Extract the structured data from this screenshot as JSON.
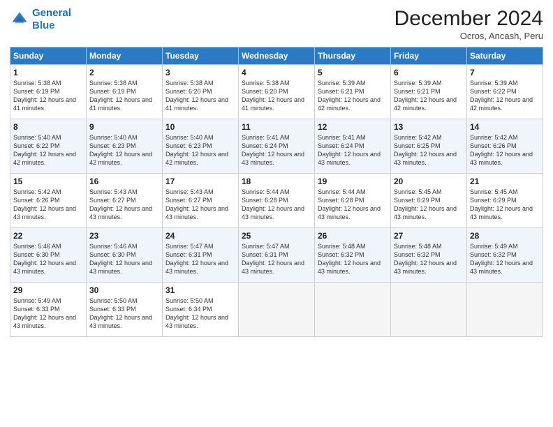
{
  "header": {
    "logo_line1": "General",
    "logo_line2": "Blue",
    "month": "December 2024",
    "location": "Ocros, Ancash, Peru"
  },
  "days_of_week": [
    "Sunday",
    "Monday",
    "Tuesday",
    "Wednesday",
    "Thursday",
    "Friday",
    "Saturday"
  ],
  "weeks": [
    [
      {
        "day": "1",
        "info": "Sunrise: 5:38 AM\nSunset: 6:19 PM\nDaylight: 12 hours and 41 minutes."
      },
      {
        "day": "2",
        "info": "Sunrise: 5:38 AM\nSunset: 6:19 PM\nDaylight: 12 hours and 41 minutes."
      },
      {
        "day": "3",
        "info": "Sunrise: 5:38 AM\nSunset: 6:20 PM\nDaylight: 12 hours and 41 minutes."
      },
      {
        "day": "4",
        "info": "Sunrise: 5:38 AM\nSunset: 6:20 PM\nDaylight: 12 hours and 41 minutes."
      },
      {
        "day": "5",
        "info": "Sunrise: 5:39 AM\nSunset: 6:21 PM\nDaylight: 12 hours and 42 minutes."
      },
      {
        "day": "6",
        "info": "Sunrise: 5:39 AM\nSunset: 6:21 PM\nDaylight: 12 hours and 42 minutes."
      },
      {
        "day": "7",
        "info": "Sunrise: 5:39 AM\nSunset: 6:22 PM\nDaylight: 12 hours and 42 minutes."
      }
    ],
    [
      {
        "day": "8",
        "info": "Sunrise: 5:40 AM\nSunset: 6:22 PM\nDaylight: 12 hours and 42 minutes."
      },
      {
        "day": "9",
        "info": "Sunrise: 5:40 AM\nSunset: 6:23 PM\nDaylight: 12 hours and 42 minutes."
      },
      {
        "day": "10",
        "info": "Sunrise: 5:40 AM\nSunset: 6:23 PM\nDaylight: 12 hours and 42 minutes."
      },
      {
        "day": "11",
        "info": "Sunrise: 5:41 AM\nSunset: 6:24 PM\nDaylight: 12 hours and 43 minutes."
      },
      {
        "day": "12",
        "info": "Sunrise: 5:41 AM\nSunset: 6:24 PM\nDaylight: 12 hours and 43 minutes."
      },
      {
        "day": "13",
        "info": "Sunrise: 5:42 AM\nSunset: 6:25 PM\nDaylight: 12 hours and 43 minutes."
      },
      {
        "day": "14",
        "info": "Sunrise: 5:42 AM\nSunset: 6:26 PM\nDaylight: 12 hours and 43 minutes."
      }
    ],
    [
      {
        "day": "15",
        "info": "Sunrise: 5:42 AM\nSunset: 6:26 PM\nDaylight: 12 hours and 43 minutes."
      },
      {
        "day": "16",
        "info": "Sunrise: 5:43 AM\nSunset: 6:27 PM\nDaylight: 12 hours and 43 minutes."
      },
      {
        "day": "17",
        "info": "Sunrise: 5:43 AM\nSunset: 6:27 PM\nDaylight: 12 hours and 43 minutes."
      },
      {
        "day": "18",
        "info": "Sunrise: 5:44 AM\nSunset: 6:28 PM\nDaylight: 12 hours and 43 minutes."
      },
      {
        "day": "19",
        "info": "Sunrise: 5:44 AM\nSunset: 6:28 PM\nDaylight: 12 hours and 43 minutes."
      },
      {
        "day": "20",
        "info": "Sunrise: 5:45 AM\nSunset: 6:29 PM\nDaylight: 12 hours and 43 minutes."
      },
      {
        "day": "21",
        "info": "Sunrise: 5:45 AM\nSunset: 6:29 PM\nDaylight: 12 hours and 43 minutes."
      }
    ],
    [
      {
        "day": "22",
        "info": "Sunrise: 5:46 AM\nSunset: 6:30 PM\nDaylight: 12 hours and 43 minutes."
      },
      {
        "day": "23",
        "info": "Sunrise: 5:46 AM\nSunset: 6:30 PM\nDaylight: 12 hours and 43 minutes."
      },
      {
        "day": "24",
        "info": "Sunrise: 5:47 AM\nSunset: 6:31 PM\nDaylight: 12 hours and 43 minutes."
      },
      {
        "day": "25",
        "info": "Sunrise: 5:47 AM\nSunset: 6:31 PM\nDaylight: 12 hours and 43 minutes."
      },
      {
        "day": "26",
        "info": "Sunrise: 5:48 AM\nSunset: 6:32 PM\nDaylight: 12 hours and 43 minutes."
      },
      {
        "day": "27",
        "info": "Sunrise: 5:48 AM\nSunset: 6:32 PM\nDaylight: 12 hours and 43 minutes."
      },
      {
        "day": "28",
        "info": "Sunrise: 5:49 AM\nSunset: 6:32 PM\nDaylight: 12 hours and 43 minutes."
      }
    ],
    [
      {
        "day": "29",
        "info": "Sunrise: 5:49 AM\nSunset: 6:33 PM\nDaylight: 12 hours and 43 minutes."
      },
      {
        "day": "30",
        "info": "Sunrise: 5:50 AM\nSunset: 6:33 PM\nDaylight: 12 hours and 43 minutes."
      },
      {
        "day": "31",
        "info": "Sunrise: 5:50 AM\nSunset: 6:34 PM\nDaylight: 12 hours and 43 minutes."
      },
      null,
      null,
      null,
      null
    ]
  ]
}
